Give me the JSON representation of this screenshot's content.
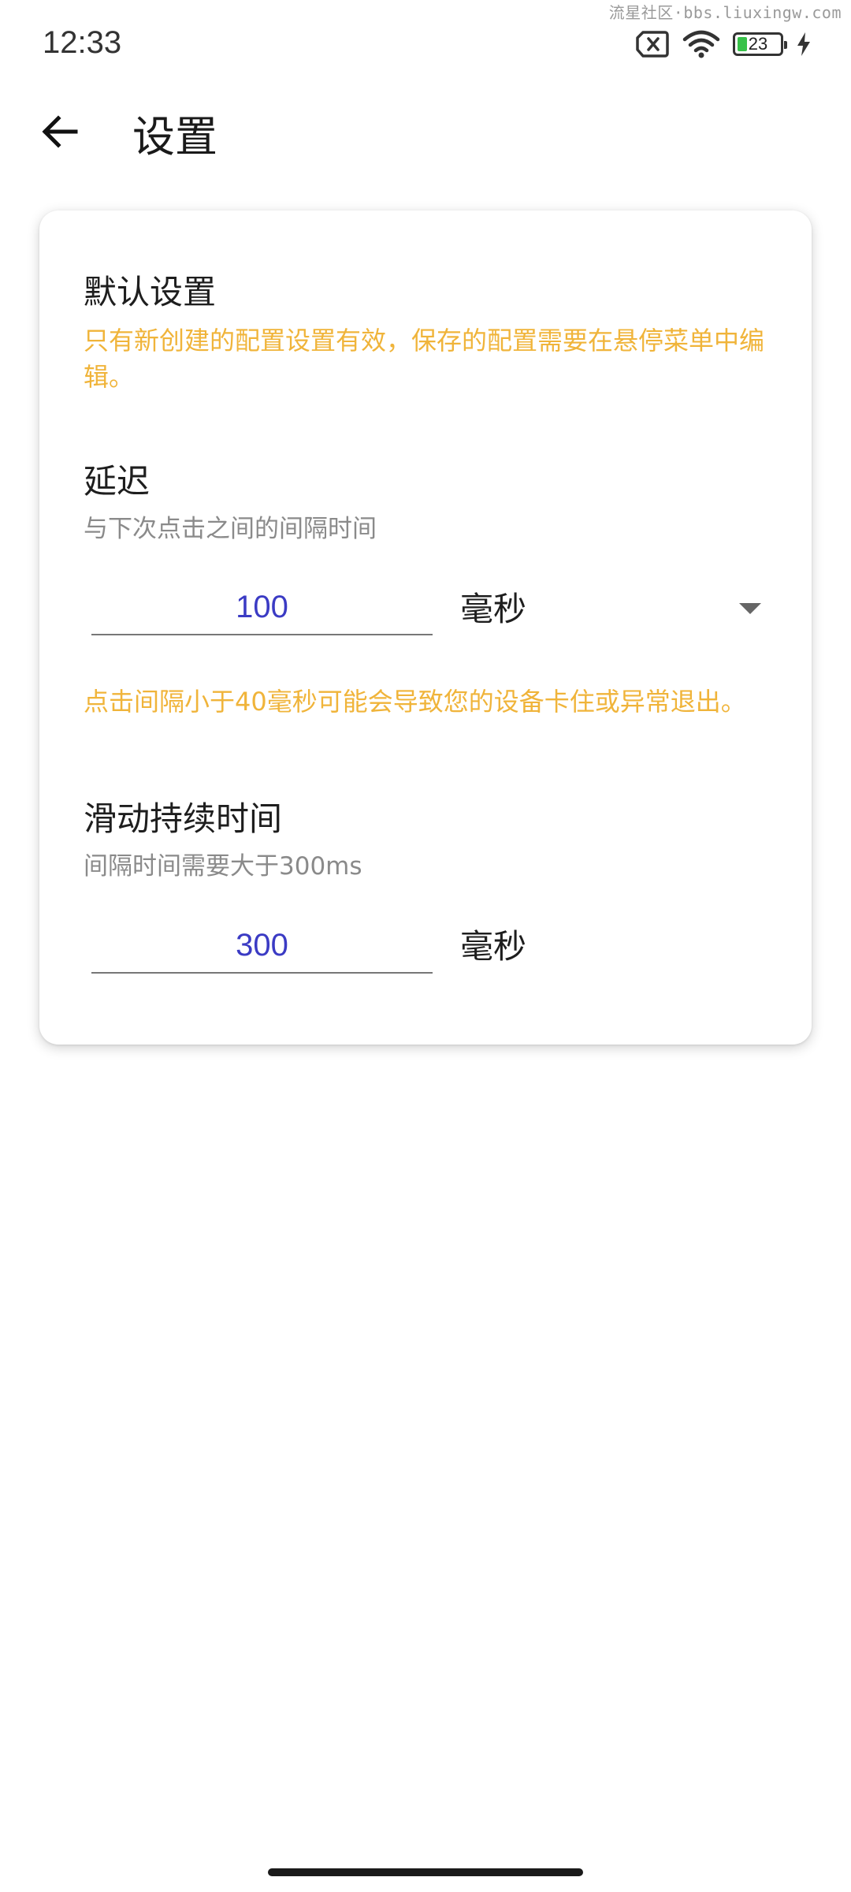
{
  "watermark": "流星社区·bbs.liuxingw.com",
  "status_bar": {
    "time": "12:33",
    "battery_level": "23",
    "battery_fraction": 0.23,
    "icons": [
      "sim-error-icon",
      "wifi-icon",
      "battery-icon",
      "charging-bolt-icon"
    ]
  },
  "app_bar": {
    "title": "设置",
    "back_icon": "arrow-left-icon"
  },
  "default_section": {
    "title": "默认设置",
    "warning": "只有新创建的配置设置有效，保存的配置需要在悬停菜单中编辑。"
  },
  "delay": {
    "title": "延迟",
    "subtitle": "与下次点击之间的间隔时间",
    "value": "100",
    "unit": "毫秒",
    "warning": "点击间隔小于40毫秒可能会导致您的设备卡住或异常退出。"
  },
  "swipe": {
    "title": "滑动持续时间",
    "subtitle": "间隔时间需要大于300ms",
    "value": "300",
    "unit": "毫秒"
  },
  "colors": {
    "accent_text": "#3b3bc4",
    "warning": "#f0b43a",
    "battery": "#38c24a"
  }
}
